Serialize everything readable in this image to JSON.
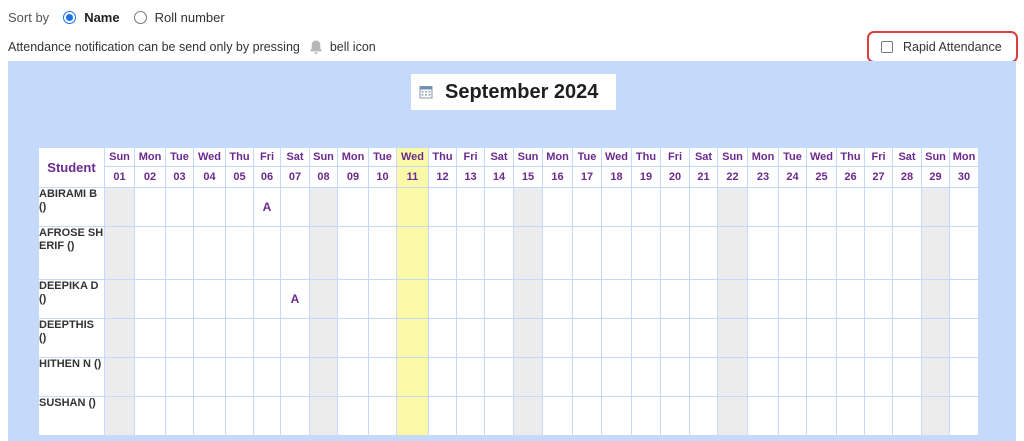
{
  "sort": {
    "label": "Sort by",
    "options": [
      {
        "label": "Name",
        "selected": true
      },
      {
        "label": "Roll number",
        "selected": false
      }
    ]
  },
  "notice": {
    "before": "Attendance notification can be send only by pressing",
    "after": "bell icon",
    "icon": "bell-icon"
  },
  "rapid": {
    "label": "Rapid Attendance",
    "checked": false
  },
  "month": {
    "title": "September 2024",
    "icon": "calendar-icon"
  },
  "table": {
    "student_header": "Student",
    "today_index": 10,
    "days": [
      {
        "dow": "Sun",
        "d": "01"
      },
      {
        "dow": "Mon",
        "d": "02"
      },
      {
        "dow": "Tue",
        "d": "03"
      },
      {
        "dow": "Wed",
        "d": "04"
      },
      {
        "dow": "Thu",
        "d": "05"
      },
      {
        "dow": "Fri",
        "d": "06"
      },
      {
        "dow": "Sat",
        "d": "07"
      },
      {
        "dow": "Sun",
        "d": "08"
      },
      {
        "dow": "Mon",
        "d": "09"
      },
      {
        "dow": "Tue",
        "d": "10"
      },
      {
        "dow": "Wed",
        "d": "11"
      },
      {
        "dow": "Thu",
        "d": "12"
      },
      {
        "dow": "Fri",
        "d": "13"
      },
      {
        "dow": "Sat",
        "d": "14"
      },
      {
        "dow": "Sun",
        "d": "15"
      },
      {
        "dow": "Mon",
        "d": "16"
      },
      {
        "dow": "Tue",
        "d": "17"
      },
      {
        "dow": "Wed",
        "d": "18"
      },
      {
        "dow": "Thu",
        "d": "19"
      },
      {
        "dow": "Fri",
        "d": "20"
      },
      {
        "dow": "Sat",
        "d": "21"
      },
      {
        "dow": "Sun",
        "d": "22"
      },
      {
        "dow": "Mon",
        "d": "23"
      },
      {
        "dow": "Tue",
        "d": "24"
      },
      {
        "dow": "Wed",
        "d": "25"
      },
      {
        "dow": "Thu",
        "d": "26"
      },
      {
        "dow": "Fri",
        "d": "27"
      },
      {
        "dow": "Sat",
        "d": "28"
      },
      {
        "dow": "Sun",
        "d": "29"
      },
      {
        "dow": "Mon",
        "d": "30"
      }
    ],
    "students": [
      {
        "name": "ABIRAMI B ()",
        "marks": {
          "06": "A"
        }
      },
      {
        "name": "AFROSE SHERIF ()",
        "marks": {}
      },
      {
        "name": "DEEPIKA D ()",
        "marks": {
          "07": "A"
        }
      },
      {
        "name": "DEEPTHIS ()",
        "marks": {}
      },
      {
        "name": "HITHEN N ()",
        "marks": {}
      },
      {
        "name": "SUSHAN ()",
        "marks": {}
      }
    ]
  },
  "colors": {
    "panel": "#c5d9fb",
    "header_text": "#6b2b8e",
    "sunday": "#ececec",
    "today": "#fbf8a8",
    "rapid_border": "#d94040",
    "radio_accent": "#1a73e8"
  }
}
